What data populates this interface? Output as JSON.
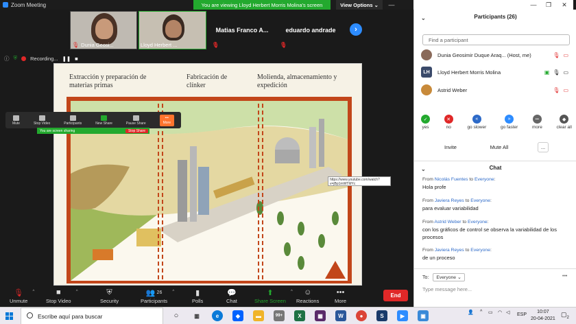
{
  "window": {
    "title": "Zoom Meeting",
    "viewing_banner": "You are viewing Lloyd Herbert Morris Molina's screen",
    "view_options": "View Options"
  },
  "strip": {
    "tiles": [
      {
        "name": "Dunia Geosi..."
      },
      {
        "name": "Lloyd Herbert ..."
      },
      {
        "name": "Matias  Franco  A..."
      },
      {
        "name": "eduardo andrade"
      }
    ]
  },
  "recording": {
    "label": "Recording..."
  },
  "shared_screen": {
    "col1": "Extracción y preparación de materias primas",
    "col2": "Fabricación de clínker",
    "col3": "Molienda, almacenamiento y expedición",
    "url_tooltip": "https://www.youtube.com/watch?v=jBp1mWTMYc"
  },
  "float_toolbar": {
    "items": [
      "Mute",
      "Stop Video",
      "Participants",
      "New Share",
      "Pause Share",
      "More"
    ],
    "participants_count": "26",
    "sharing_label": "You are screen sharing",
    "stop_share": "Stop Share"
  },
  "toolbar": {
    "unmute": "Unmute",
    "stop_video": "Stop Video",
    "security": "Security",
    "participants": "Participants",
    "participants_count": "26",
    "polls": "Polls",
    "chat": "Chat",
    "share_screen": "Share Screen",
    "reactions": "Reactions",
    "more": "More",
    "end": "End"
  },
  "participants_panel": {
    "title": "Participants (26)",
    "search_placeholder": "Find a participant",
    "people": [
      {
        "name": "Dunia Geosimir Duque Araq... (Host, me)",
        "initials": "",
        "color": "#8a6a5a"
      },
      {
        "name": "Lloyd Herbert Morris Molina",
        "initials": "LH",
        "color": "#3a4a6a"
      },
      {
        "name": "Astrid Weber",
        "initials": "",
        "color": "#c88a3a"
      }
    ],
    "reactions": [
      {
        "label": "yes",
        "color": "#23a92e",
        "glyph": "✓"
      },
      {
        "label": "no",
        "color": "#e02828",
        "glyph": "✕"
      },
      {
        "label": "go slower",
        "color": "#2d6ac8",
        "glyph": "«"
      },
      {
        "label": "go faster",
        "color": "#2d8cff",
        "glyph": "»"
      },
      {
        "label": "more",
        "color": "#666666",
        "glyph": "•••"
      },
      {
        "label": "clear all",
        "color": "#555555",
        "glyph": "◆"
      }
    ],
    "invite": "Invite",
    "mute_all": "Mute All",
    "more": "..."
  },
  "chat_panel": {
    "title": "Chat",
    "messages": [
      {
        "from_word": "From",
        "sender": "Nicolás Fuentes",
        "to_word": "to",
        "recipient": "Everyone",
        "text": "Hola profe"
      },
      {
        "from_word": "From",
        "sender": "Javiera Reyes",
        "to_word": "to",
        "recipient": "Everyone",
        "text": "para evaluar variabilidad"
      },
      {
        "from_word": "From",
        "sender": "Astrid Weber",
        "to_word": "to",
        "recipient": "Everyone",
        "text": "con los gráficos de control se observa la variabilidad de los procesos"
      },
      {
        "from_word": "From",
        "sender": "Javiera Reyes",
        "to_word": "to",
        "recipient": "Everyone",
        "text": "de un proceso"
      }
    ],
    "to_label": "To:",
    "to_value": "Everyone",
    "input_placeholder": "Type message here..."
  },
  "taskbar": {
    "search": "Escribe aquí para buscar",
    "lang": "ESP",
    "time": "10:07",
    "date": "20-04-2021",
    "notif_count": "2",
    "badge": "99+"
  }
}
